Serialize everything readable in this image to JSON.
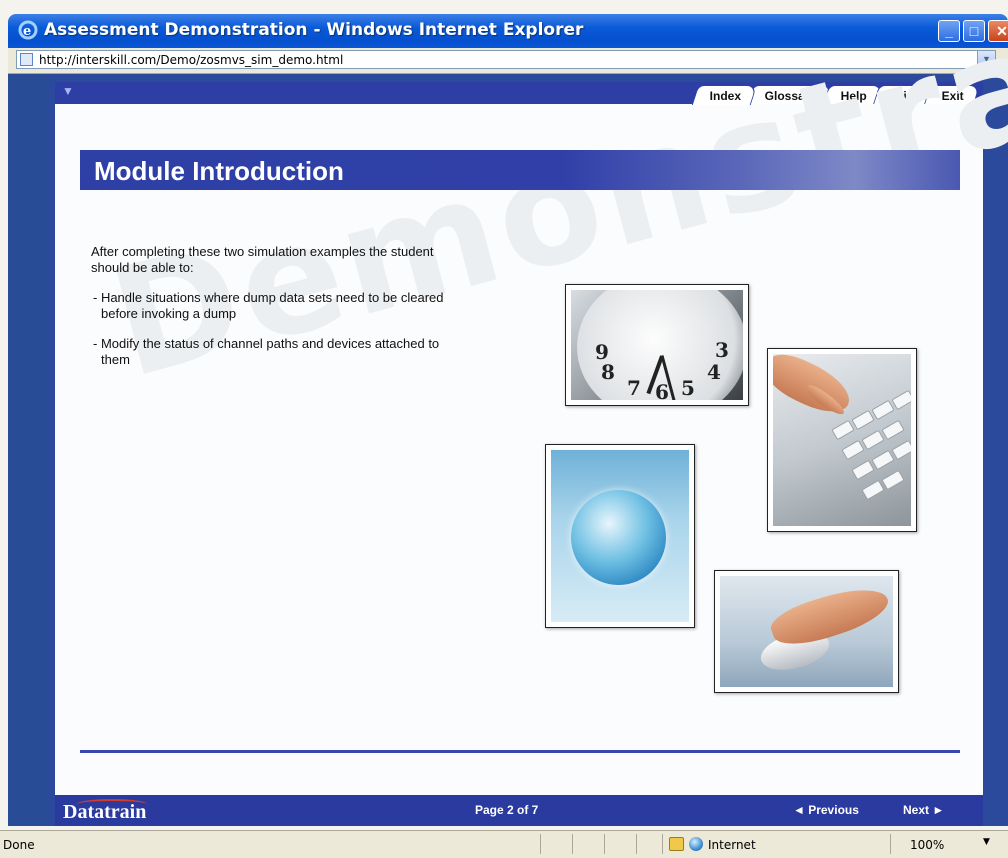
{
  "window": {
    "title": "Assessment Demonstration - Windows Internet Explorer",
    "url": "http://interskill.com/Demo/zosmvs_sim_demo.html"
  },
  "app": {
    "tabs": [
      "Index",
      "Glossary",
      "Help",
      "Print",
      "Exit"
    ],
    "module_title": "Module Introduction",
    "watermark": "Demonstration",
    "intro": "After completing these two simulation examples the student should be able to:",
    "bullets": [
      "- Handle situations where dump data sets need to be cleared before invoking a dump",
      "- Modify the status of channel paths and devices attached to them"
    ],
    "clock_numbers": [
      "8",
      "7",
      "6",
      "5",
      "4",
      "3",
      "9"
    ]
  },
  "footer": {
    "brand": "Datatrain",
    "page": "Page 2 of 7",
    "previous": "◄ Previous",
    "next": "Next ►"
  },
  "status": {
    "text": "Done",
    "zone": "Internet",
    "zoom": "100%"
  }
}
